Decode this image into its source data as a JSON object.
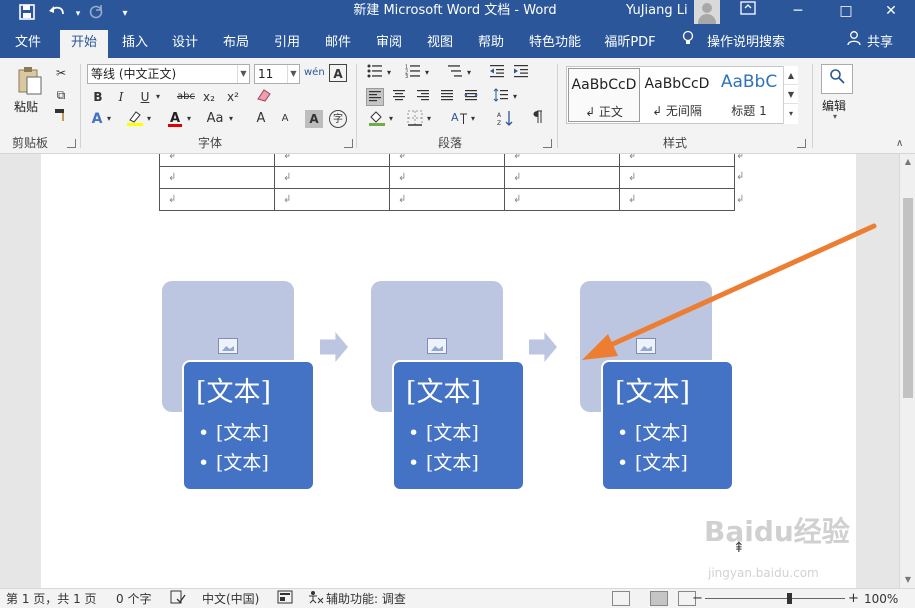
{
  "titlebar": {
    "title": "新建 Microsoft Word 文档  -  Word",
    "user": "YuJiang Li",
    "minimize": "─",
    "maximize": "□",
    "close": "✕",
    "save_icon": "save-icon",
    "undo_icon": "undo-icon",
    "redo_icon": "redo-icon",
    "customize_icon": "customize-icon"
  },
  "menu": {
    "tabs": [
      {
        "label": "文件"
      },
      {
        "label": "开始"
      },
      {
        "label": "插入"
      },
      {
        "label": "设计"
      },
      {
        "label": "布局"
      },
      {
        "label": "引用"
      },
      {
        "label": "邮件"
      },
      {
        "label": "审阅"
      },
      {
        "label": "视图"
      },
      {
        "label": "帮助"
      },
      {
        "label": "特色功能"
      },
      {
        "label": "福昕PDF"
      }
    ],
    "tell_me": "操作说明搜索",
    "share": "共享",
    "active": "开始"
  },
  "ribbon": {
    "clipboard": {
      "paste": "粘贴",
      "label": "剪贴板"
    },
    "font": {
      "font_name": "等线 (中文正文)",
      "font_size": "11",
      "label": "字体",
      "bold": "B",
      "italic": "I",
      "underline": "U",
      "strike": "abc",
      "subscript": "x₂",
      "superscript": "x²",
      "grow": "A",
      "shrink": "A",
      "aa": "Aa",
      "phonetic": "wén",
      "charborder": "A",
      "charshade": "A",
      "encircle": "字"
    },
    "paragraph": {
      "label": "段落"
    },
    "styles": {
      "label": "样式",
      "items": [
        {
          "preview": "AaBbCcD",
          "name": "↲ 正文"
        },
        {
          "preview": "AaBbCcD",
          "name": "↲ 无间隔"
        },
        {
          "preview": "AaBbC",
          "name": "标题 1"
        }
      ]
    },
    "editing": {
      "label": "编辑"
    }
  },
  "document": {
    "table_rows": [
      [
        "↲",
        "↲",
        "↲",
        "↲",
        "↲"
      ],
      [
        "↲",
        "↲",
        "↲",
        "↲",
        "↲"
      ],
      [
        "↲",
        "↲",
        "↲",
        "↲",
        "↲"
      ]
    ],
    "row_mark": "↲",
    "smartart": [
      {
        "title": "[文本]",
        "bullets": [
          "[文本]",
          "[文本]"
        ]
      },
      {
        "title": "[文本]",
        "bullets": [
          "[文本]",
          "[文本]"
        ]
      },
      {
        "title": "[文本]",
        "bullets": [
          "[文本]",
          "[文本]"
        ]
      }
    ],
    "colors": {
      "shape_back": "#bcc6e0",
      "shape_front": "#4472c4",
      "annotation_arrow": "#ed7d31"
    }
  },
  "status": {
    "page": "第 1 页，共 1 页",
    "words": "0 个字",
    "language": "中文(中国)",
    "accessibility": "辅助功能: 调查",
    "zoom": "100%",
    "zoom_minus": "−",
    "zoom_plus": "+"
  },
  "watermark": {
    "main": "Baidu经验",
    "sub": "jingyan.baidu.com"
  }
}
